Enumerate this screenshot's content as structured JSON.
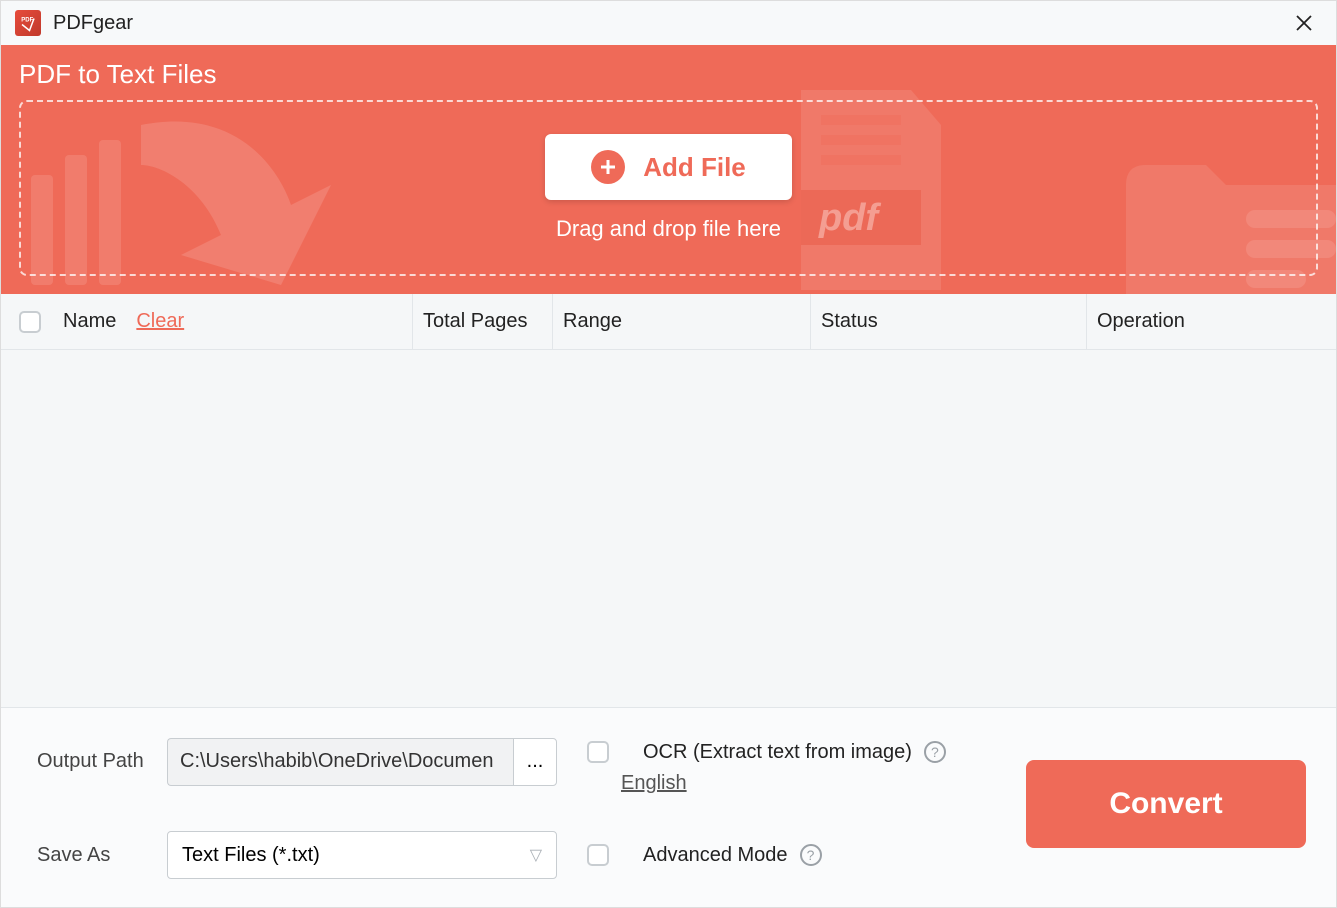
{
  "app": {
    "title": "PDFgear"
  },
  "header": {
    "title": "PDF to Text Files",
    "add_file": "Add File",
    "drag_drop": "Drag and drop file here"
  },
  "table": {
    "columns": {
      "name": "Name",
      "pages": "Total Pages",
      "range": "Range",
      "status": "Status",
      "operation": "Operation"
    },
    "clear": "Clear"
  },
  "footer": {
    "output_path_label": "Output Path",
    "output_path_value": "C:\\Users\\habib\\OneDrive\\Documen",
    "browse": "...",
    "save_as_label": "Save As",
    "save_as_value": "Text Files (*.txt)",
    "ocr_label": "OCR (Extract text from image)",
    "ocr_language": "English",
    "advanced_label": "Advanced Mode",
    "convert": "Convert"
  }
}
